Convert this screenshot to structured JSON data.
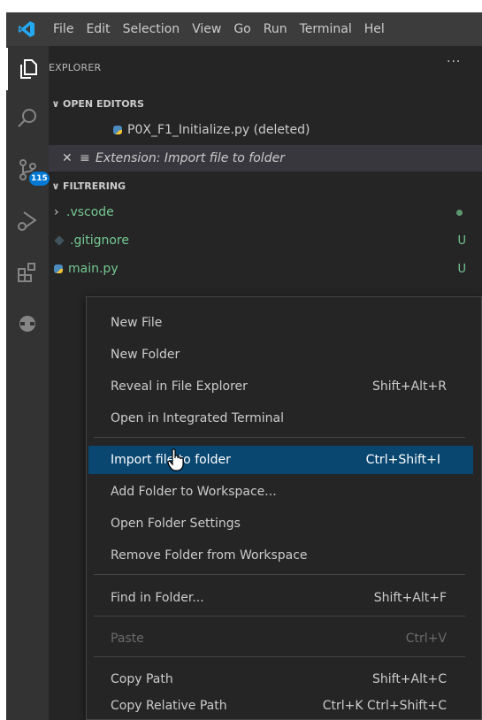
{
  "titlebar": {
    "menus": [
      "File",
      "Edit",
      "Selection",
      "View",
      "Go",
      "Run",
      "Terminal",
      "Hel"
    ]
  },
  "activity_bar": {
    "items": [
      {
        "name": "explorer",
        "icon": "files-icon"
      },
      {
        "name": "search",
        "icon": "search-icon"
      },
      {
        "name": "source-control",
        "icon": "source-control-icon",
        "badge": "115"
      },
      {
        "name": "run-debug",
        "icon": "run-debug-icon"
      },
      {
        "name": "extensions",
        "icon": "extensions-icon"
      },
      {
        "name": "remote",
        "icon": "remote-icon"
      }
    ]
  },
  "explorer": {
    "title": "EXPLORER",
    "more": "···",
    "open_editors": {
      "label": "OPEN EDITORS",
      "items": [
        {
          "label": "P0X_F1_Initialize.py (deleted)"
        },
        {
          "label": "Extension: Import file to folder"
        }
      ]
    },
    "folder": {
      "label": "FILTRERING",
      "items": [
        {
          "label": ".vscode",
          "status": "●"
        },
        {
          "label": ".gitignore",
          "status": "U"
        },
        {
          "label": "main.py",
          "status": "U"
        }
      ]
    }
  },
  "context_menu": {
    "items": [
      {
        "label": "New File",
        "shortcut": ""
      },
      {
        "label": "New Folder",
        "shortcut": ""
      },
      {
        "label": "Reveal in File Explorer",
        "shortcut": "Shift+Alt+R"
      },
      {
        "label": "Open in Integrated Terminal",
        "shortcut": ""
      },
      {
        "label": "Import file to folder",
        "shortcut": "Ctrl+Shift+I"
      },
      {
        "label": "Add Folder to Workspace...",
        "shortcut": ""
      },
      {
        "label": "Open Folder Settings",
        "shortcut": ""
      },
      {
        "label": "Remove Folder from Workspace",
        "shortcut": ""
      },
      {
        "label": "Find in Folder...",
        "shortcut": "Shift+Alt+F"
      },
      {
        "label": "Paste",
        "shortcut": "Ctrl+V"
      },
      {
        "label": "Copy Path",
        "shortcut": "Shift+Alt+C"
      },
      {
        "label": "Copy Relative Path",
        "shortcut": "Ctrl+K Ctrl+Shift+C"
      }
    ]
  },
  "colors": {
    "accent": "#0078d4",
    "highlight": "#094771",
    "git_untracked": "#73c991"
  }
}
